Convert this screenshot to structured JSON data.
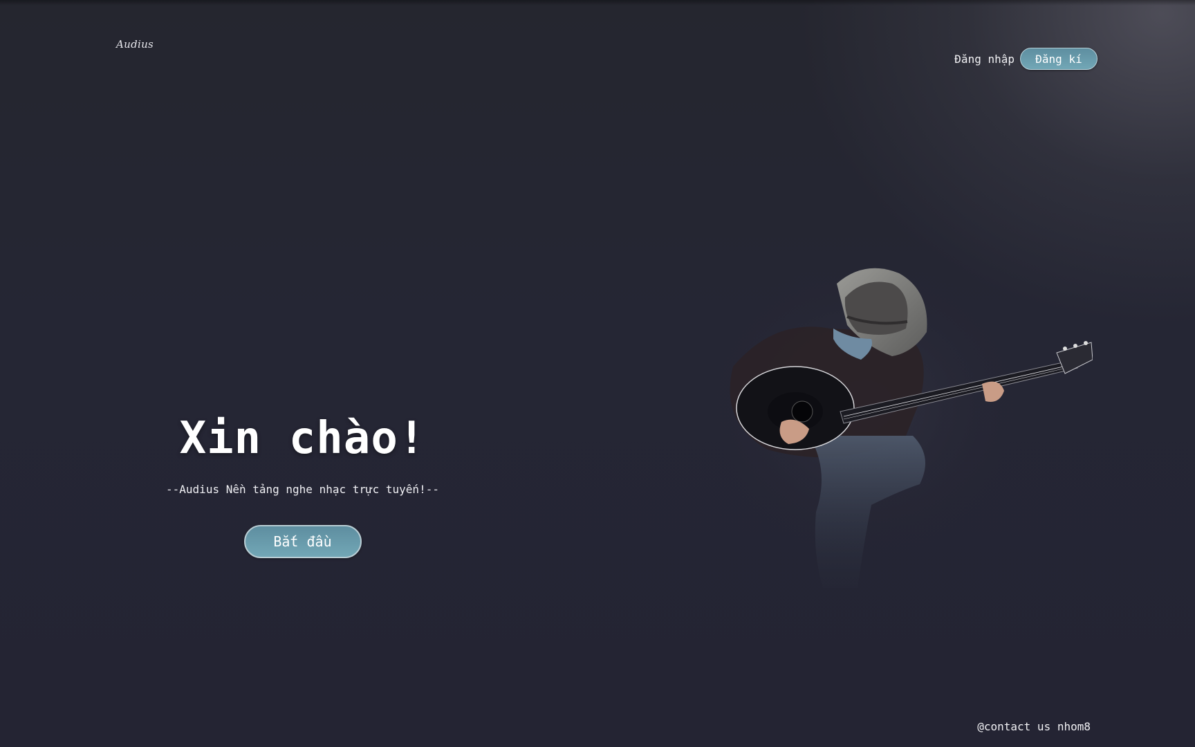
{
  "header": {
    "logo_text": "Audius",
    "login_label": "Đăng nhập",
    "register_label": "Đăng kí"
  },
  "hero": {
    "title": "Xin chào!",
    "subtitle": "--Audius Nền tảng nghe nhạc trực tuyến!--",
    "start_label": "Bắt đầu"
  },
  "footer": {
    "contact_text": "@contact us nhom8"
  },
  "colors": {
    "background": "#252634",
    "accent_button": "#6a9dad",
    "button_border": "#b9d2da",
    "text": "#ffffff"
  },
  "icons": [
    "guitarist-illustration"
  ]
}
